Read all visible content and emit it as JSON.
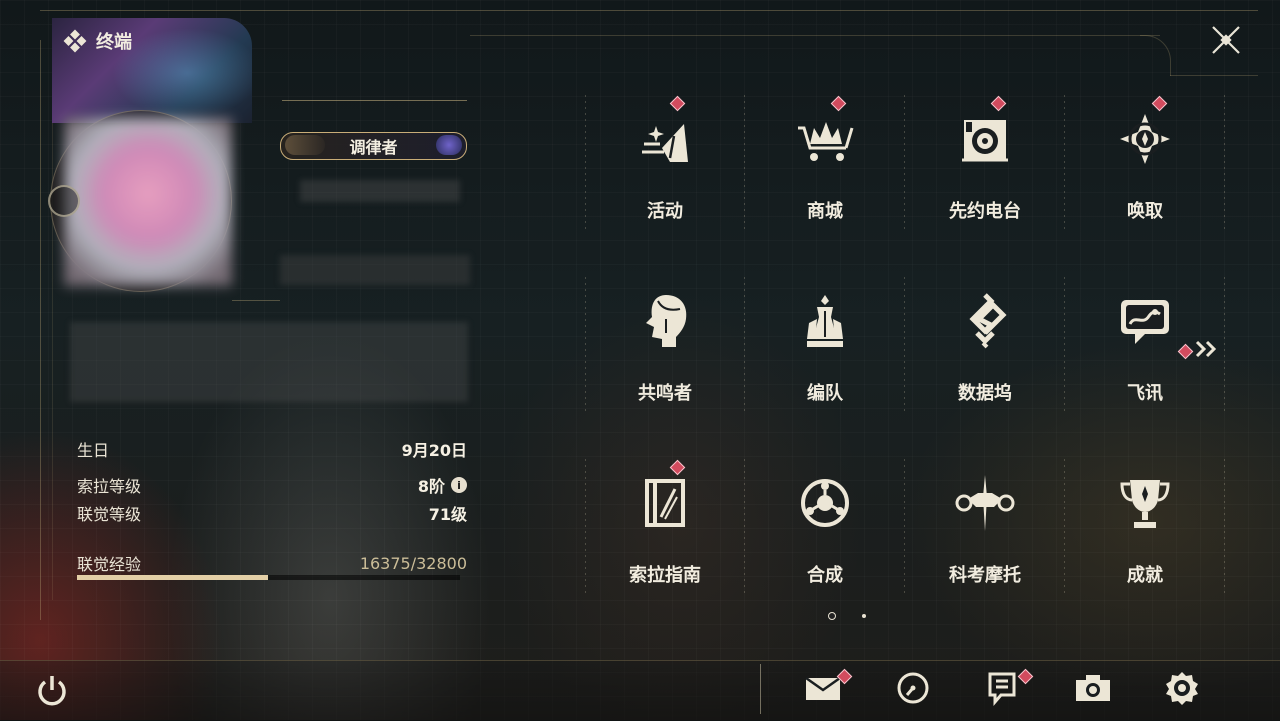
{
  "window": {
    "title": "终端"
  },
  "profile": {
    "role_label": "调律者",
    "birthday_label": "生日",
    "birthday_value": "9月20日",
    "sola_level_label": "索拉等级",
    "sola_level_value": "8阶",
    "sola_level_info": "i",
    "union_level_label": "联觉等级",
    "union_level_value": "71级",
    "union_exp_label": "联觉经验",
    "union_exp_value": "16375/32800",
    "union_exp_progress": 0.4992
  },
  "menu": {
    "items": [
      {
        "label": "活动",
        "icon": "event-icon",
        "badge": true
      },
      {
        "label": "商城",
        "icon": "shop-icon",
        "badge": true
      },
      {
        "label": "先约电台",
        "icon": "radio-icon",
        "badge": true
      },
      {
        "label": "唤取",
        "icon": "convene-icon",
        "badge": true
      },
      {
        "label": "共鸣者",
        "icon": "resonator-icon",
        "badge": false
      },
      {
        "label": "编队",
        "icon": "team-icon",
        "badge": false
      },
      {
        "label": "数据坞",
        "icon": "data-bank-icon",
        "badge": false
      },
      {
        "label": "飞讯",
        "icon": "message-icon",
        "badge": false
      },
      {
        "label": "索拉指南",
        "icon": "guidebook-icon",
        "badge": true
      },
      {
        "label": "合成",
        "icon": "synthesis-icon",
        "badge": false
      },
      {
        "label": "科考摩托",
        "icon": "motorcycle-icon",
        "badge": false
      },
      {
        "label": "成就",
        "icon": "trophy-icon",
        "badge": false
      }
    ],
    "page_count": 2,
    "current_page": 1
  },
  "bottom_bar": {
    "icons": [
      "power-icon",
      "mail-icon",
      "clock-icon",
      "notice-icon",
      "camera-icon",
      "settings-icon"
    ]
  },
  "colors": {
    "accent_gold": "#c9ad78",
    "badge_red": "#d24b5e",
    "text": "#f1ecdf"
  }
}
